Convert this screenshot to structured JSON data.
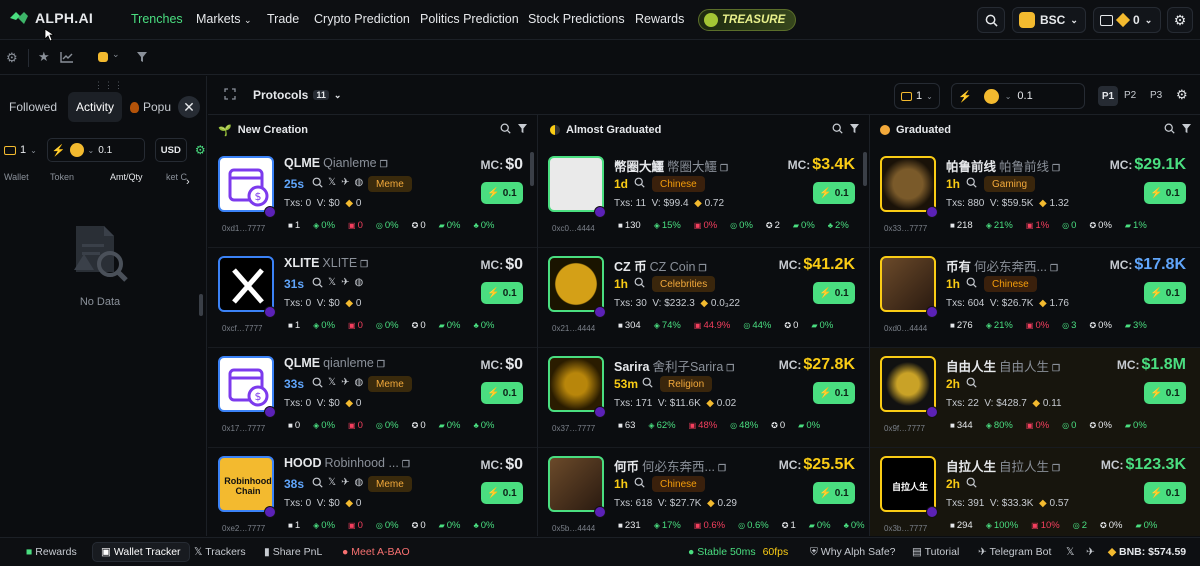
{
  "brand": {
    "name": "ALPH.AI",
    "accent": "#4ade80"
  },
  "nav": {
    "items": [
      "Trenches",
      "Markets",
      "Trade",
      "Crypto Prediction",
      "Politics Prediction",
      "Stock Predictions",
      "Rewards"
    ],
    "treasure": "TREASURE"
  },
  "header": {
    "chain": "BSC",
    "wallet_balance": "0"
  },
  "sidebar": {
    "tabs": [
      "Followed",
      "Activity",
      "Popu"
    ],
    "folder_count": "1",
    "quick_amount": "0.1",
    "currency": "USD",
    "columns": [
      "Wallet",
      "Token",
      "Amt/Qty",
      "ket C"
    ],
    "empty_text": "No Data"
  },
  "main": {
    "protocols_label": "Protocols",
    "protocols_count": "11",
    "folder_count": "1",
    "quick_amount": "0.1",
    "presets": [
      "P1",
      "P2",
      "P3"
    ]
  },
  "columns": [
    {
      "title": "New Creation",
      "cards": [
        {
          "symbol": "QLME",
          "name": "Qianleme",
          "age": "25s",
          "tag": "Meme",
          "txs": "0",
          "volume": "$0",
          "fees": "0",
          "mc": "$0",
          "buy": "0.1",
          "addr": "0xd1…7777",
          "stats": [
            "1",
            "0%",
            "0",
            "0%",
            "0",
            "0%",
            "0%"
          ],
          "thumb": "calendar"
        },
        {
          "symbol": "XLITE",
          "name": "XLITE",
          "age": "31s",
          "tag": "",
          "txs": "0",
          "volume": "$0",
          "fees": "0",
          "mc": "$0",
          "buy": "0.1",
          "addr": "0xcf…7777",
          "stats": [
            "1",
            "0%",
            "0",
            "0%",
            "0",
            "0%",
            "0%"
          ],
          "thumb": "x"
        },
        {
          "symbol": "QLME",
          "name": "qianleme",
          "age": "33s",
          "tag": "Meme",
          "txs": "0",
          "volume": "$0",
          "fees": "0",
          "mc": "$0",
          "buy": "0.1",
          "addr": "0x17…7777",
          "stats": [
            "0",
            "0%",
            "0",
            "0%",
            "0",
            "0%",
            "0%"
          ],
          "thumb": "calendar"
        },
        {
          "symbol": "HOOD",
          "name": "Robinhood ...",
          "age": "38s",
          "tag": "Meme",
          "txs": "0",
          "volume": "$0",
          "fees": "0",
          "mc": "$0",
          "buy": "0.1",
          "addr": "0xe2…7777",
          "stats": [
            "1",
            "0%",
            "0",
            "0%",
            "0",
            "0%",
            "0%"
          ],
          "thumb": "robinhood",
          "thumb_text": "Robinhood Chain"
        }
      ]
    },
    {
      "title": "Almost Graduated",
      "cards": [
        {
          "symbol": "幣圈大鱷",
          "name": "幣圈大鱷",
          "age": "1d",
          "tag": "Chinese",
          "txs": "11",
          "volume": "$99.4",
          "fees": "0.72",
          "mc": "$3.4K",
          "buy": "0.1",
          "addr": "0xc0…4444",
          "stats": [
            "130",
            "15%",
            "0%",
            "0%",
            "2",
            "0%",
            "2%"
          ],
          "thumb": "croc"
        },
        {
          "symbol": "CZ 币",
          "name": "CZ Coin",
          "age": "1h",
          "tag": "Celebrities",
          "txs": "30",
          "volume": "$232.3",
          "fees": "0.0₃22",
          "mc": "$41.2K",
          "buy": "0.1",
          "addr": "0x21…4444",
          "stats": [
            "304",
            "74%",
            "44.9%",
            "44%",
            "0",
            "0%",
            ""
          ],
          "thumb": "coin"
        },
        {
          "symbol": "Sarira",
          "name": "舍利子Sarira",
          "age": "53m",
          "tag": "Religion",
          "txs": "171",
          "volume": "$11.6K",
          "fees": "0.02",
          "mc": "$27.8K",
          "buy": "0.1",
          "addr": "0x37…7777",
          "stats": [
            "63",
            "62%",
            "48%",
            "48%",
            "0",
            "0%",
            ""
          ],
          "thumb": "gold"
        },
        {
          "symbol": "何币",
          "name": "何必东奔西...",
          "age": "1h",
          "tag": "Chinese",
          "txs": "618",
          "volume": "$27.7K",
          "fees": "0.29",
          "mc": "$25.5K",
          "buy": "0.1",
          "addr": "0x5b…4444",
          "stats": [
            "231",
            "17%",
            "0.6%",
            "0.6%",
            "1",
            "0%",
            "0%"
          ],
          "thumb": "men"
        }
      ]
    },
    {
      "title": "Graduated",
      "cards": [
        {
          "symbol": "帕鲁前线",
          "name": "帕鲁前线",
          "age": "1h",
          "tag": "Gaming",
          "txs": "880",
          "volume": "$59.5K",
          "fees": "1.32",
          "mc": "$29.1K",
          "buy": "0.1",
          "addr": "0x33…7777",
          "stats": [
            "218",
            "21%",
            "1%",
            "0",
            "0%",
            "1%",
            ""
          ],
          "thumb": "circle"
        },
        {
          "symbol": "币有",
          "name": "何必东奔西...",
          "age": "1h",
          "tag": "Chinese",
          "txs": "604",
          "volume": "$26.7K",
          "fees": "1.76",
          "mc": "$17.8K",
          "buy": "0.1",
          "addr": "0xd0…4444",
          "stats": [
            "276",
            "21%",
            "0%",
            "3",
            "0%",
            "3%",
            ""
          ],
          "thumb": "men"
        },
        {
          "symbol": "自由人生",
          "name": "自由人生",
          "age": "2h",
          "tag": "",
          "txs": "22",
          "volume": "$428.7",
          "fees": "0.11",
          "mc": "$1.8M",
          "buy": "0.1",
          "addr": "0x9f…7777",
          "stats": [
            "344",
            "80%",
            "0%",
            "0",
            "0%",
            "0%",
            ""
          ],
          "thumb": "eagle"
        },
        {
          "symbol": "自拉人生",
          "name": "自拉人生",
          "age": "2h",
          "tag": "",
          "txs": "391",
          "volume": "$33.3K",
          "fees": "0.57",
          "mc": "$123.3K",
          "buy": "0.1",
          "addr": "0x3b…7777",
          "stats": [
            "294",
            "100%",
            "10%",
            "2",
            "0%",
            "0%",
            ""
          ],
          "thumb": "textlogo",
          "thumb_text": "自拉人生"
        }
      ]
    }
  ],
  "bottom": {
    "items": [
      "Rewards",
      "Wallet Tracker",
      "Trackers",
      "Share PnL",
      "Meet A-BAO"
    ],
    "status": "Stable 50ms",
    "fps": "60fps",
    "links": [
      "Why Alph Safe?",
      "Tutorial",
      "Telegram Bot"
    ],
    "price": "BNB: $574.59"
  }
}
